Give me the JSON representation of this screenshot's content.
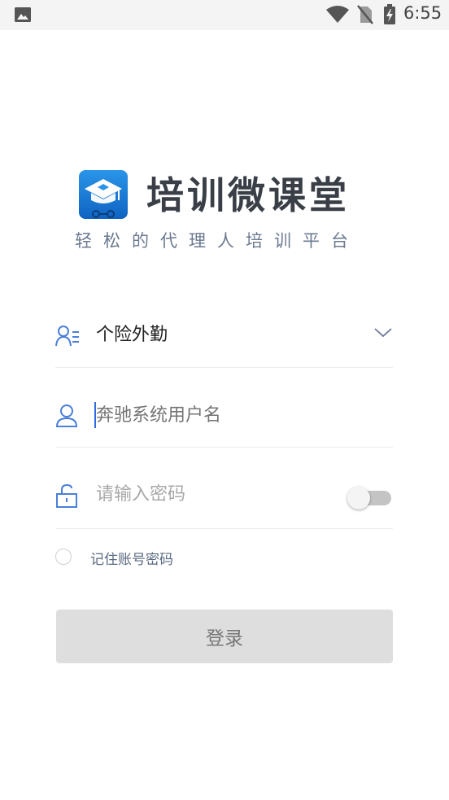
{
  "status_bar": {
    "time": "6:55",
    "icons": [
      "gallery-icon",
      "wifi-icon",
      "no-sim-icon",
      "battery-charging-icon"
    ]
  },
  "app": {
    "title": "培训微课堂",
    "subtitle": "轻松的代理人培训平台",
    "logo_icon": "graduation-cap-logo-icon",
    "logo_color": "#1a7fd6"
  },
  "form": {
    "company": {
      "icon": "user-list-icon",
      "value": "个险外勤",
      "arrow_icon": "chevron-down-icon"
    },
    "username": {
      "icon": "user-icon",
      "placeholder": "奔驰系统用户名",
      "value": ""
    },
    "password": {
      "icon": "lock-icon",
      "placeholder": "请输入密码",
      "show_password_toggle": false
    },
    "remember": {
      "label": "记住账号密码",
      "checked": false
    },
    "login_button": {
      "label": "登录"
    }
  },
  "colors": {
    "accent": "#2c6be0",
    "icon_blue": "#4a7fd9",
    "title_text": "#3a3f47",
    "subtitle_text": "#6b7a90",
    "button_disabled_bg": "#dedede"
  }
}
